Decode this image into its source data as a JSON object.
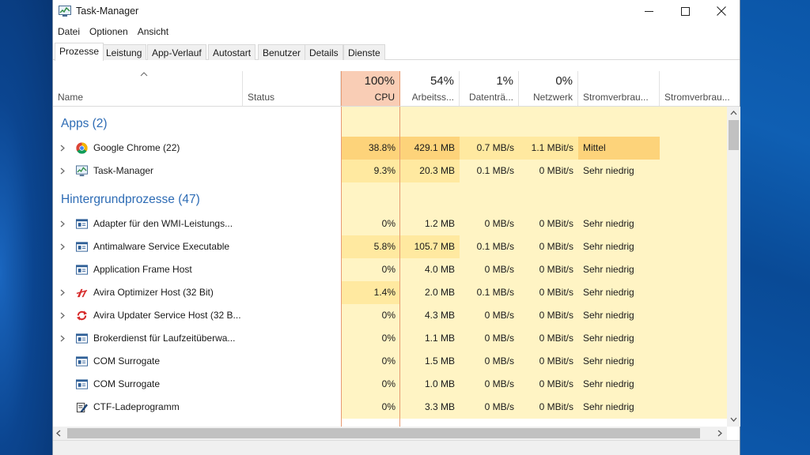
{
  "window": {
    "title": "Task-Manager"
  },
  "menu": [
    "Datei",
    "Optionen",
    "Ansicht"
  ],
  "tabs": [
    "Prozesse",
    "Leistung",
    "App-Verlauf",
    "Autostart",
    "Benutzer",
    "Details",
    "Dienste"
  ],
  "active_tab": "Prozesse",
  "columns": {
    "name": "Name",
    "status": "Status",
    "cpu": {
      "percent": "100%",
      "label": "CPU"
    },
    "memory": {
      "percent": "54%",
      "label": "Arbeitss..."
    },
    "disk": {
      "percent": "1%",
      "label": "Datenträ..."
    },
    "network": {
      "percent": "0%",
      "label": "Netzwerk"
    },
    "power": "Stromverbrau...",
    "power_trend": "Stromverbrau..."
  },
  "groups": {
    "apps": "Apps (2)",
    "background": "Hintergrundprozesse (47)"
  },
  "apps": [
    {
      "name": "Google Chrome (22)",
      "icon": "chrome-icon",
      "expandable": true,
      "cpu": "38.8%",
      "mem": "429.1 MB",
      "disk": "0.7 MB/s",
      "net": "1.1 MBit/s",
      "power": "Mittel"
    },
    {
      "name": "Task-Manager",
      "icon": "task-manager-icon",
      "expandable": true,
      "cpu": "9.3%",
      "mem": "20.3 MB",
      "disk": "0.1 MB/s",
      "net": "0 MBit/s",
      "power": "Sehr niedrig"
    }
  ],
  "background": [
    {
      "name": "Adapter für den WMI-Leistungs...",
      "icon": "service-window-icon",
      "expandable": true,
      "cpu": "0%",
      "mem": "1.2 MB",
      "disk": "0 MB/s",
      "net": "0 MBit/s",
      "power": "Sehr niedrig"
    },
    {
      "name": "Antimalware Service Executable",
      "icon": "service-window-icon",
      "expandable": true,
      "cpu": "5.8%",
      "mem": "105.7 MB",
      "disk": "0.1 MB/s",
      "net": "0 MBit/s",
      "power": "Sehr niedrig"
    },
    {
      "name": "Application Frame Host",
      "icon": "service-window-icon",
      "expandable": false,
      "cpu": "0%",
      "mem": "4.0 MB",
      "disk": "0 MB/s",
      "net": "0 MBit/s",
      "power": "Sehr niedrig"
    },
    {
      "name": "Avira Optimizer Host (32 Bit)",
      "icon": "avira-optimizer-icon",
      "expandable": true,
      "cpu": "1.4%",
      "mem": "2.0 MB",
      "disk": "0.1 MB/s",
      "net": "0 MBit/s",
      "power": "Sehr niedrig"
    },
    {
      "name": "Avira Updater Service Host (32 B...",
      "icon": "avira-updater-icon",
      "expandable": true,
      "cpu": "0%",
      "mem": "4.3 MB",
      "disk": "0 MB/s",
      "net": "0 MBit/s",
      "power": "Sehr niedrig"
    },
    {
      "name": "Brokerdienst für Laufzeitüberwa...",
      "icon": "service-window-icon",
      "expandable": true,
      "cpu": "0%",
      "mem": "1.1 MB",
      "disk": "0 MB/s",
      "net": "0 MBit/s",
      "power": "Sehr niedrig"
    },
    {
      "name": "COM Surrogate",
      "icon": "service-window-icon",
      "expandable": false,
      "cpu": "0%",
      "mem": "1.5 MB",
      "disk": "0 MB/s",
      "net": "0 MBit/s",
      "power": "Sehr niedrig"
    },
    {
      "name": "COM Surrogate",
      "icon": "service-window-icon",
      "expandable": false,
      "cpu": "0%",
      "mem": "1.0 MB",
      "disk": "0 MB/s",
      "net": "0 MBit/s",
      "power": "Sehr niedrig"
    },
    {
      "name": "CTF-Ladeprogramm",
      "icon": "ctf-loader-icon",
      "expandable": false,
      "cpu": "0%",
      "mem": "3.3 MB",
      "disk": "0 MB/s",
      "net": "0 MBit/s",
      "power": "Sehr niedrig"
    }
  ],
  "colors": {
    "group_title": "#2e6cb5",
    "cpu_header": "#f9cdb5",
    "cell_light": "#fff4c4",
    "cell_medium": "#ffe9a0",
    "cell_high": "#fdd37a"
  }
}
